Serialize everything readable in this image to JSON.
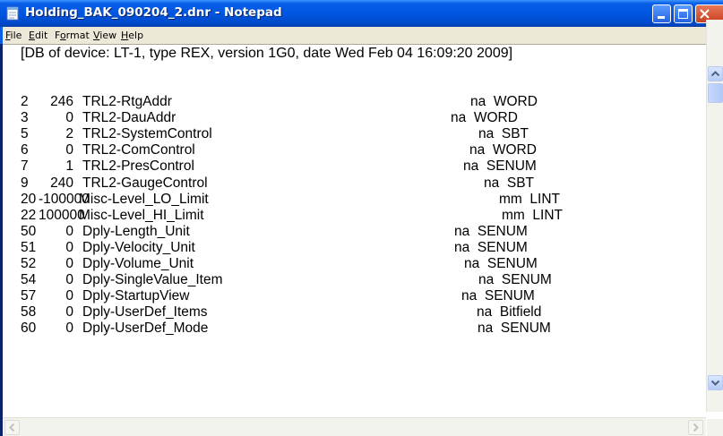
{
  "window": {
    "title": "Holding_BAK_090204_2.dnr - Notepad"
  },
  "menu": [
    {
      "u": "F",
      "rest": "ile"
    },
    {
      "u": "E",
      "rest": "dit"
    },
    {
      "pre": "F",
      "u": "o",
      "rest": "rmat"
    },
    {
      "u": "V",
      "rest": "iew"
    },
    {
      "u": "H",
      "rest": "elp"
    }
  ],
  "editor": {
    "header": "[DB of device: LT-1, type REX, version 1G0, date Wed Feb 04 16:09:20 2009]",
    "rows": [
      {
        "reg": "2",
        "value": "246",
        "name": "TRL2-RtgAddr",
        "unit": "na",
        "type": "WORD"
      },
      {
        "reg": "3",
        "value": "0",
        "name": "TRL2-DauAddr",
        "unit": "na",
        "type": "WORD"
      },
      {
        "reg": "5",
        "value": "2",
        "name": "TRL2-SystemControl",
        "unit": "na",
        "type": "SBT"
      },
      {
        "reg": "6",
        "value": "0",
        "name": "TRL2-ComControl",
        "unit": "na",
        "type": "WORD"
      },
      {
        "reg": "7",
        "value": "1",
        "name": "TRL2-PresControl",
        "unit": "na",
        "type": "SENUM"
      },
      {
        "reg": "9",
        "value": "240",
        "name": "TRL2-GaugeControl",
        "unit": "na",
        "type": "SBT"
      },
      {
        "reg": "20",
        "value": "-100000",
        "name": "Misc-Level_LO_Limit",
        "unit": "mm",
        "type": "LINT"
      },
      {
        "reg": "22",
        "value": "100000",
        "name": "Misc-Level_HI_Limit",
        "unit": "mm",
        "type": "LINT"
      },
      {
        "reg": "50",
        "value": "0",
        "name": "Dply-Length_Unit",
        "unit": "na",
        "type": "SENUM"
      },
      {
        "reg": "51",
        "value": "0",
        "name": "Dply-Velocity_Unit",
        "unit": "na",
        "type": "SENUM"
      },
      {
        "reg": "52",
        "value": "0",
        "name": "Dply-Volume_Unit",
        "unit": "na",
        "type": "SENUM"
      },
      {
        "reg": "54",
        "value": "0",
        "name": "Dply-SingleValue_Item",
        "unit": "na",
        "type": "SENUM"
      },
      {
        "reg": "57",
        "value": "0",
        "name": "Dply-StartupView",
        "unit": "na",
        "type": "SENUM"
      },
      {
        "reg": "58",
        "value": "0",
        "name": "Dply-UserDef_Items",
        "unit": "na",
        "type": "Bitfield"
      },
      {
        "reg": "60",
        "value": "0",
        "name": "Dply-UserDef_Mode",
        "unit": "na",
        "type": "SENUM"
      }
    ]
  },
  "colors": {
    "titlebar": "#0054e3",
    "menubar": "#ece9d8",
    "close_button": "#d4502a"
  }
}
